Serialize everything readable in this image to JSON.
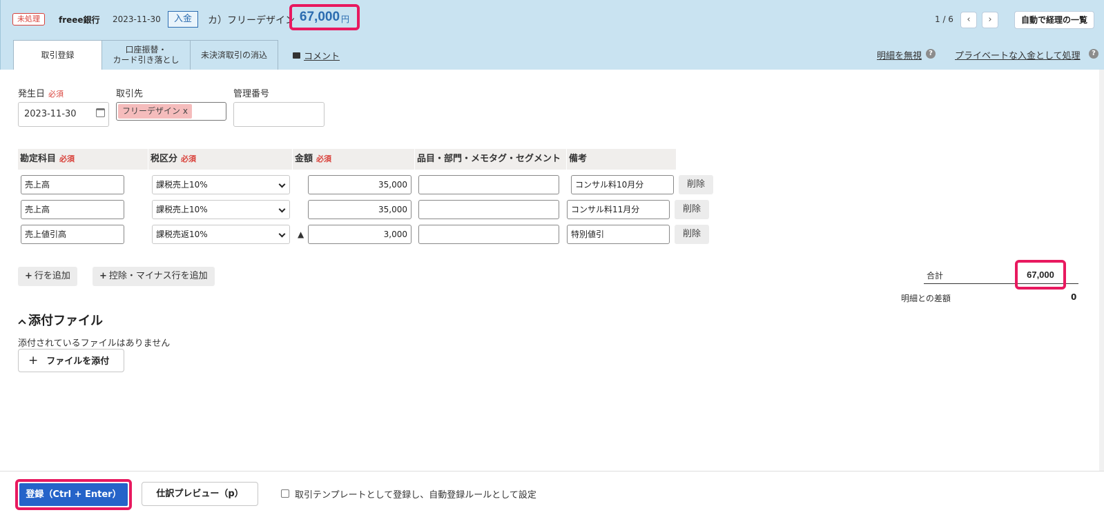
{
  "header": {
    "status": "未処理",
    "bank": "freee銀行",
    "date": "2023-11-30",
    "type": "入金",
    "partner": "カ）フリーデザイン",
    "amount": "67,000",
    "currency": "円",
    "pager": "1 / 6",
    "prev": "‹",
    "next": "›",
    "auto_list_label": "自動で経理の一覧"
  },
  "tabs": [
    {
      "label": "取引登録"
    },
    {
      "label": "口座振替・\nカード引き落とし"
    },
    {
      "label": "未決済取引の消込"
    }
  ],
  "comment_label": "コメント",
  "links": {
    "ignore": "明細を無視",
    "private": "プライベートな入金として処理",
    "help": "?"
  },
  "form": {
    "date_label": "発生日",
    "required": "必須",
    "date_value": "2023-11-30",
    "partner_label": "取引先",
    "partner_tag": "フリーデザイン x",
    "mgmt_label": "管理番号"
  },
  "table": {
    "headers": {
      "account": "勘定科目",
      "tax": "税区分",
      "amount": "金額",
      "item": "品目・部門・メモタグ・セグメント",
      "note": "備考"
    },
    "rows": [
      {
        "account": "売上高",
        "tax": "課税売上10%",
        "amount": "35,000",
        "item": "",
        "note": "コンサル料10月分"
      },
      {
        "account": "売上高",
        "tax": "課税売上10%",
        "amount": "35,000",
        "item": "",
        "note": "コンサル料11月分"
      },
      {
        "account": "売上値引高",
        "tax": "課税売返10%",
        "amount": "3,000",
        "item": "",
        "note": "特別値引"
      }
    ],
    "delete_label": "削除",
    "minus_mark": "▲"
  },
  "add_row_label": "行を追加",
  "add_minus_row_label": "控除・マイナス行を追加",
  "plus": "+",
  "totals": {
    "total_label": "合計",
    "total_value": "67,000",
    "diff_label": "明細との差額",
    "diff_value": "0"
  },
  "attachments": {
    "title": "添付ファイル",
    "empty": "添付されているファイルはありません",
    "attach_btn": "ファイルを添付",
    "plus": "+"
  },
  "footer": {
    "submit": "登録（Ctrl + Enter）",
    "preview": "仕訳プレビュー（p）",
    "template_checkbox": "取引テンプレートとして登録し、自動登録ルールとして設定"
  },
  "colors": {
    "header_bg": "#c9e3f1",
    "highlight": "#e8195f",
    "primary": "#2563c9",
    "required": "#d9413a"
  }
}
